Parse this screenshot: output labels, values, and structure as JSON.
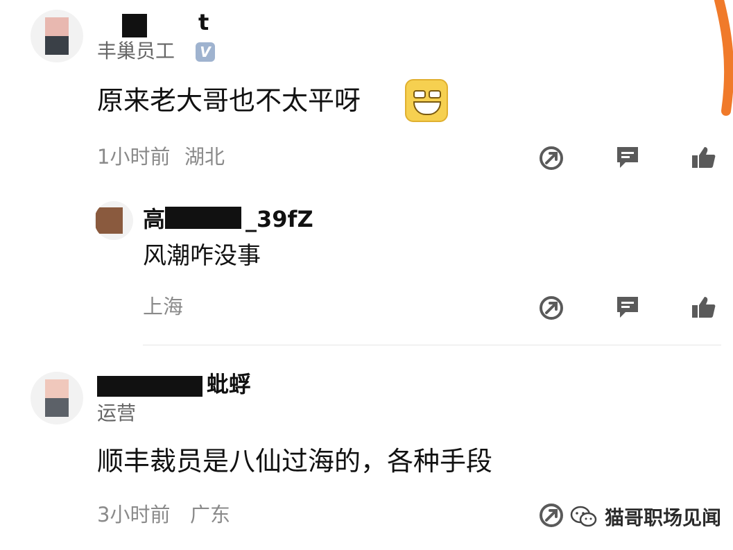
{
  "comments": [
    {
      "name_visible": "t",
      "role": "丰巢员工",
      "verified_badge": "V",
      "text": "原来老大哥也不太平呀",
      "time": "1小时前",
      "location": "湖北",
      "reply": {
        "name_visible_start": "高",
        "name_visible_end": "_39fZ",
        "text": "风潮咋没事",
        "location": "上海"
      }
    },
    {
      "name_visible": "蚍蜉",
      "role": "运营",
      "text": "顺丰裁员是八仙过海的，各种手段",
      "time": "3小时前",
      "location": "广东"
    }
  ],
  "icons": [
    "share-icon",
    "comment-icon",
    "like-icon"
  ],
  "watermark": {
    "text": "猫哥职场见闻",
    "icon": "wechat-icon"
  },
  "colors": {
    "accent_stroke": "#f07a2a",
    "icon_gray": "#5a5a5a",
    "meta_gray": "#8a8a8a"
  }
}
